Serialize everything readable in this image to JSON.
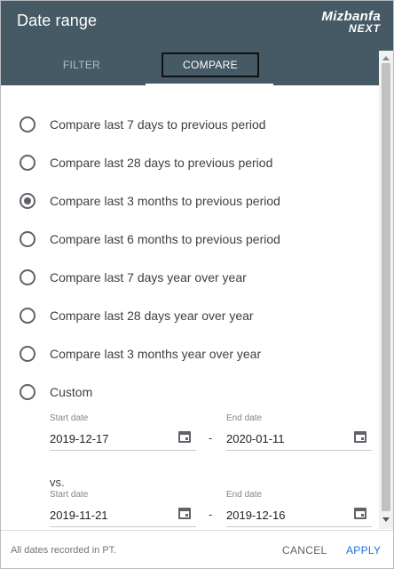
{
  "dialog": {
    "title": "Date range",
    "logo": {
      "line1": "Mizbanfa",
      "line2": "NEXT"
    }
  },
  "tabs": [
    {
      "label": "FILTER",
      "active": false
    },
    {
      "label": "COMPARE",
      "active": true
    }
  ],
  "options": [
    {
      "label": "Compare last 7 days to previous period",
      "checked": false
    },
    {
      "label": "Compare last 28 days to previous period",
      "checked": false
    },
    {
      "label": "Compare last 3 months to previous period",
      "checked": true
    },
    {
      "label": "Compare last 6 months to previous period",
      "checked": false
    },
    {
      "label": "Compare last 7 days year over year",
      "checked": false
    },
    {
      "label": "Compare last 28 days year over year",
      "checked": false
    },
    {
      "label": "Compare last 3 months year over year",
      "checked": false
    },
    {
      "label": "Custom",
      "checked": false
    }
  ],
  "custom": {
    "range1": {
      "start_caption": "Start date",
      "start_value": "2019-12-17",
      "end_caption": "End date",
      "end_value": "2020-01-11"
    },
    "separator": "-",
    "vs_label": "vs.",
    "range2": {
      "start_caption": "Start date",
      "start_value": "2019-11-21",
      "end_caption": "End date",
      "end_value": "2019-12-16"
    }
  },
  "footer": {
    "note": "All dates recorded in PT.",
    "cancel_label": "CANCEL",
    "apply_label": "APPLY"
  },
  "colors": {
    "header_bg": "#455a64",
    "accent": "#1a73e8",
    "radio": "#5f6368"
  },
  "icons": {
    "calendar": "calendar-icon",
    "scroll_up": "chevron-up-icon",
    "scroll_down": "chevron-down-icon"
  }
}
